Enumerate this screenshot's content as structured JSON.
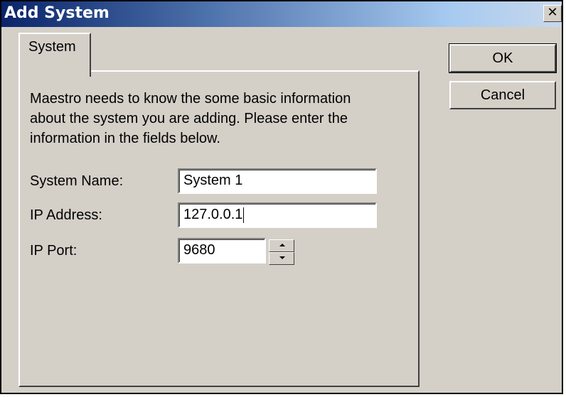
{
  "window": {
    "title": "Add System",
    "close_glyph": "✕"
  },
  "tabs": [
    {
      "label": "System",
      "selected": true
    }
  ],
  "panel": {
    "description_lines": [
      "Maestro needs to know the some basic information",
      "about the system you are adding.  Please enter the",
      "information in the fields below."
    ],
    "fields": {
      "system_name": {
        "label": "System Name:",
        "value": "System 1"
      },
      "ip_address": {
        "label": "IP Address:",
        "value": "127.0.0.1"
      },
      "ip_port": {
        "label": "IP Port:",
        "value": "9680"
      }
    }
  },
  "buttons": {
    "ok": "OK",
    "cancel": "Cancel"
  },
  "colors": {
    "dialog_face": "#d4d0c8",
    "title_gradient_start": "#0a246a",
    "title_gradient_end": "#a6caf0"
  }
}
